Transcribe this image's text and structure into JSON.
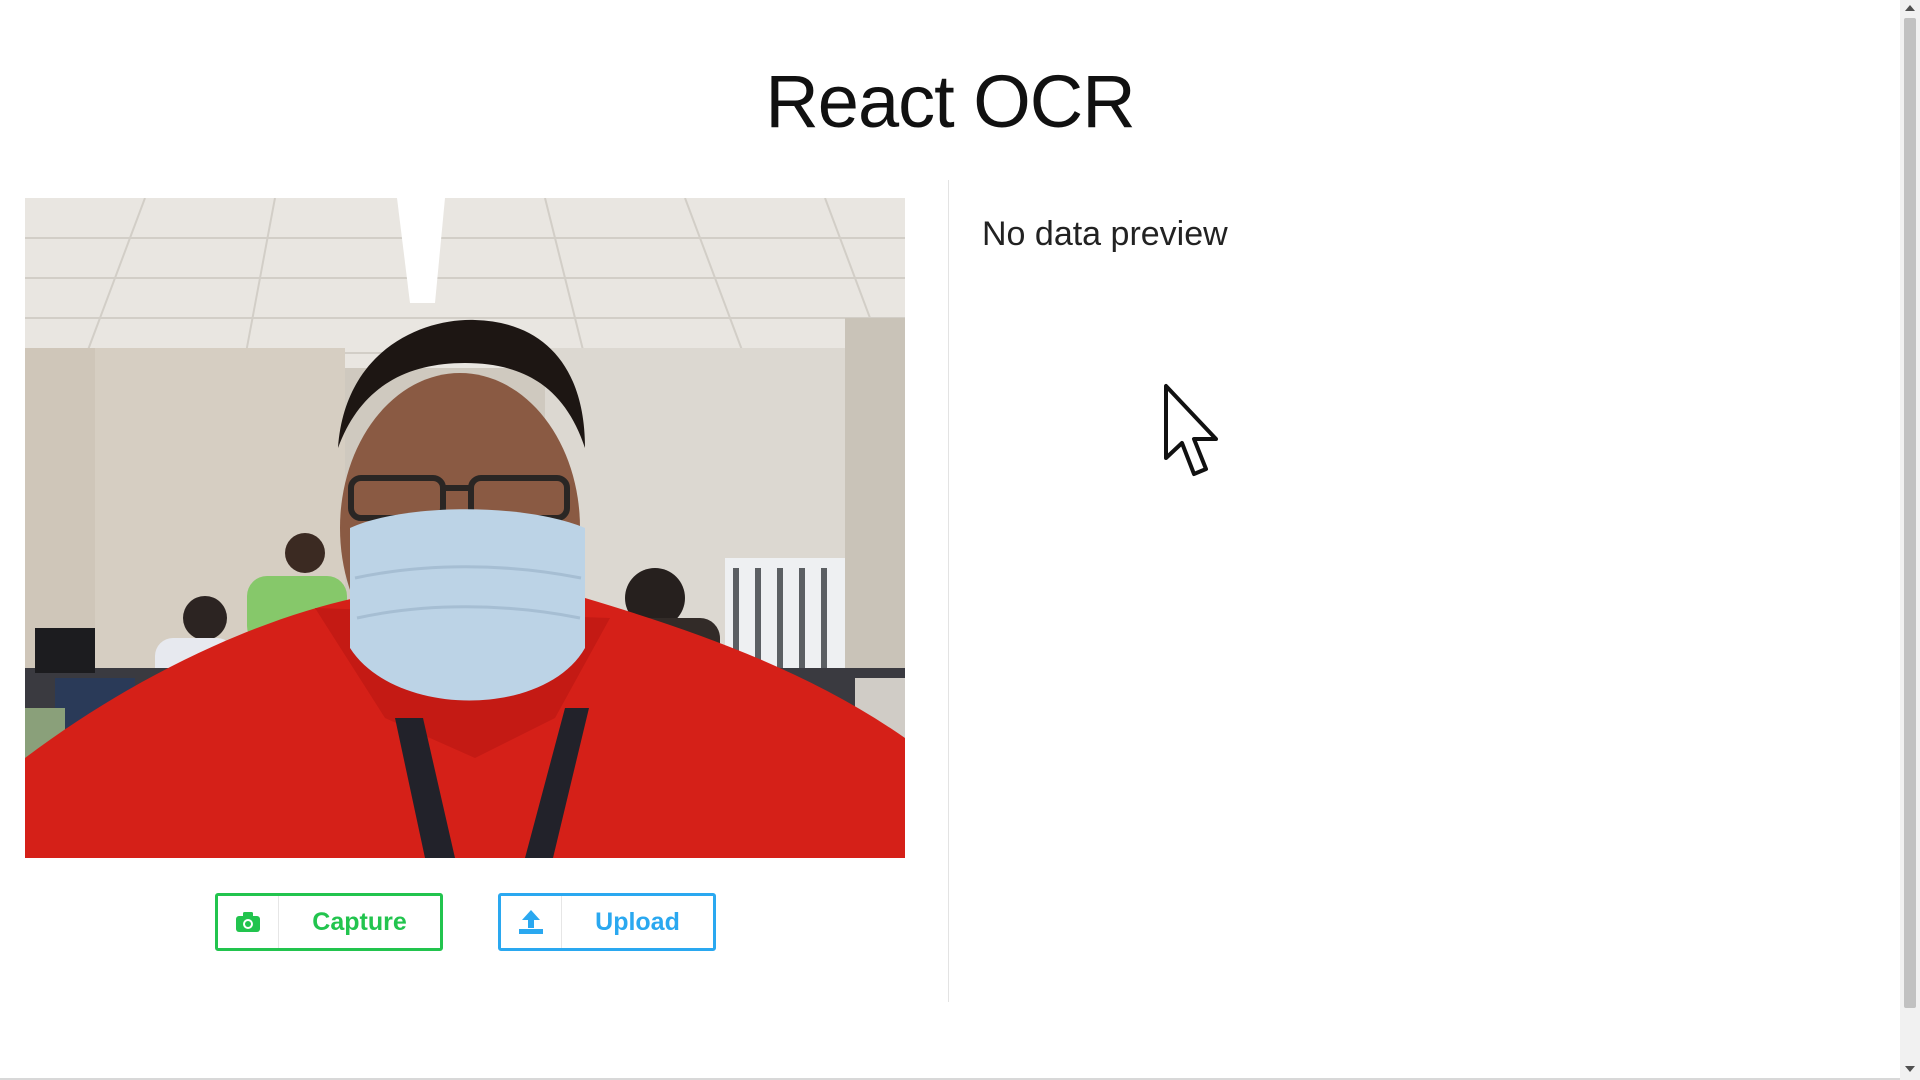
{
  "header": {
    "title": "React OCR"
  },
  "webcam": {
    "description_icon": "webcam-feed"
  },
  "preview": {
    "empty_text": "No data preview"
  },
  "actions": {
    "capture_label": "Capture",
    "capture_icon": "camera-icon",
    "upload_label": "Upload",
    "upload_icon": "upload-icon"
  },
  "colors": {
    "capture": "#22c44e",
    "upload": "#2aa8f0",
    "title": "#111111"
  }
}
